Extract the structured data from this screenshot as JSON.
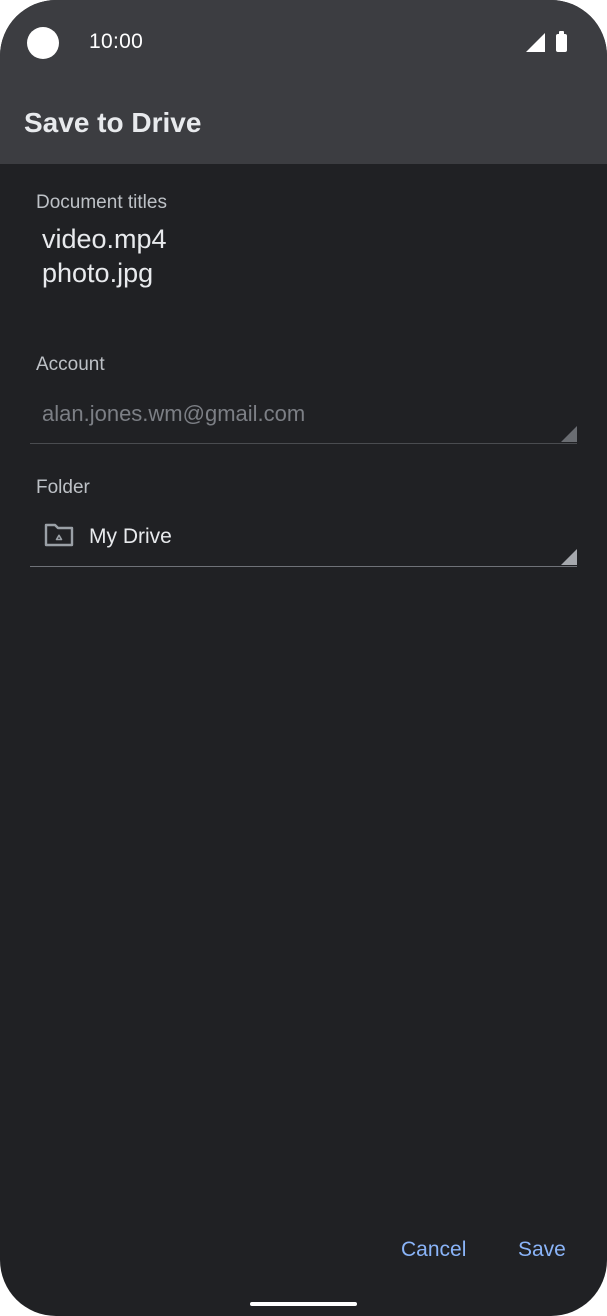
{
  "status_bar": {
    "time": "10:00",
    "icons": [
      "camera-icon",
      "signal-icon",
      "battery-icon"
    ]
  },
  "app_bar": {
    "title": "Save to Drive"
  },
  "document_titles": {
    "label": "Document titles",
    "items": [
      "video.mp4",
      "photo.jpg"
    ]
  },
  "account": {
    "label": "Account",
    "value": "alan.jones.wm@gmail.com"
  },
  "folder": {
    "label": "Folder",
    "icon": "drive-folder-icon",
    "value": "My Drive"
  },
  "actions": {
    "cancel_label": "Cancel",
    "save_label": "Save"
  },
  "colors": {
    "background": "#202124",
    "app_bar": "#3c3d41",
    "accent": "#8ab4f8",
    "text_primary": "#e8eaed",
    "text_disabled": "#7c7f85"
  }
}
